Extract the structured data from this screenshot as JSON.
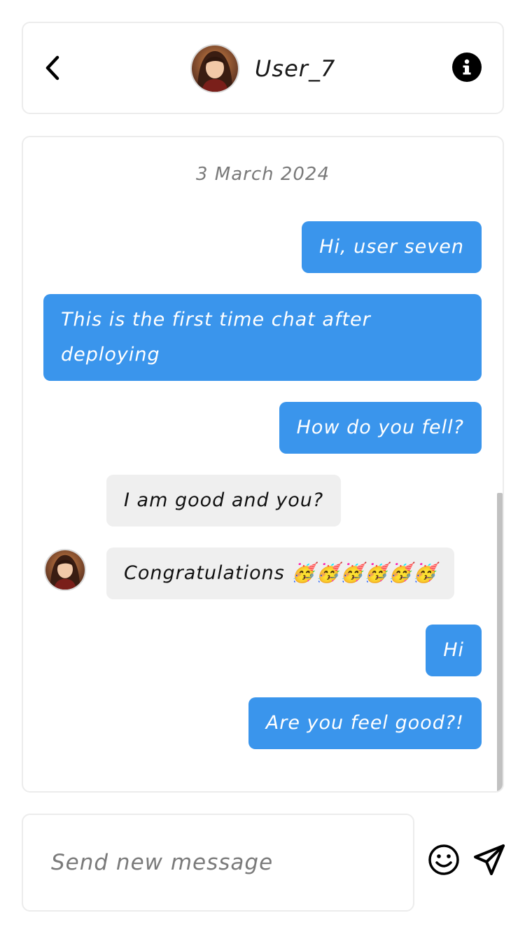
{
  "header": {
    "username": "User_7",
    "back_icon": "chevron-left-icon",
    "info_icon": "info-icon"
  },
  "chat": {
    "date": "3 March 2024",
    "messages": [
      {
        "direction": "out",
        "text": "Hi, user seven"
      },
      {
        "direction": "out",
        "text": "This is the first time chat after deploying"
      },
      {
        "direction": "out",
        "text": "How do you fell?"
      },
      {
        "direction": "in",
        "text": "I am good and you?"
      },
      {
        "direction": "in",
        "text": "Congratulations 🥳🥳🥳🥳🥳🥳"
      },
      {
        "direction": "out",
        "text": "Hi"
      },
      {
        "direction": "out",
        "text": "Are you feel good?!"
      }
    ]
  },
  "composer": {
    "placeholder": "Send new message",
    "emoji_icon": "smiley-icon",
    "send_icon": "paper-plane-icon"
  },
  "colors": {
    "outgoing_bubble": "#3a95ec",
    "incoming_bubble": "#efefef",
    "border": "#ececec"
  }
}
